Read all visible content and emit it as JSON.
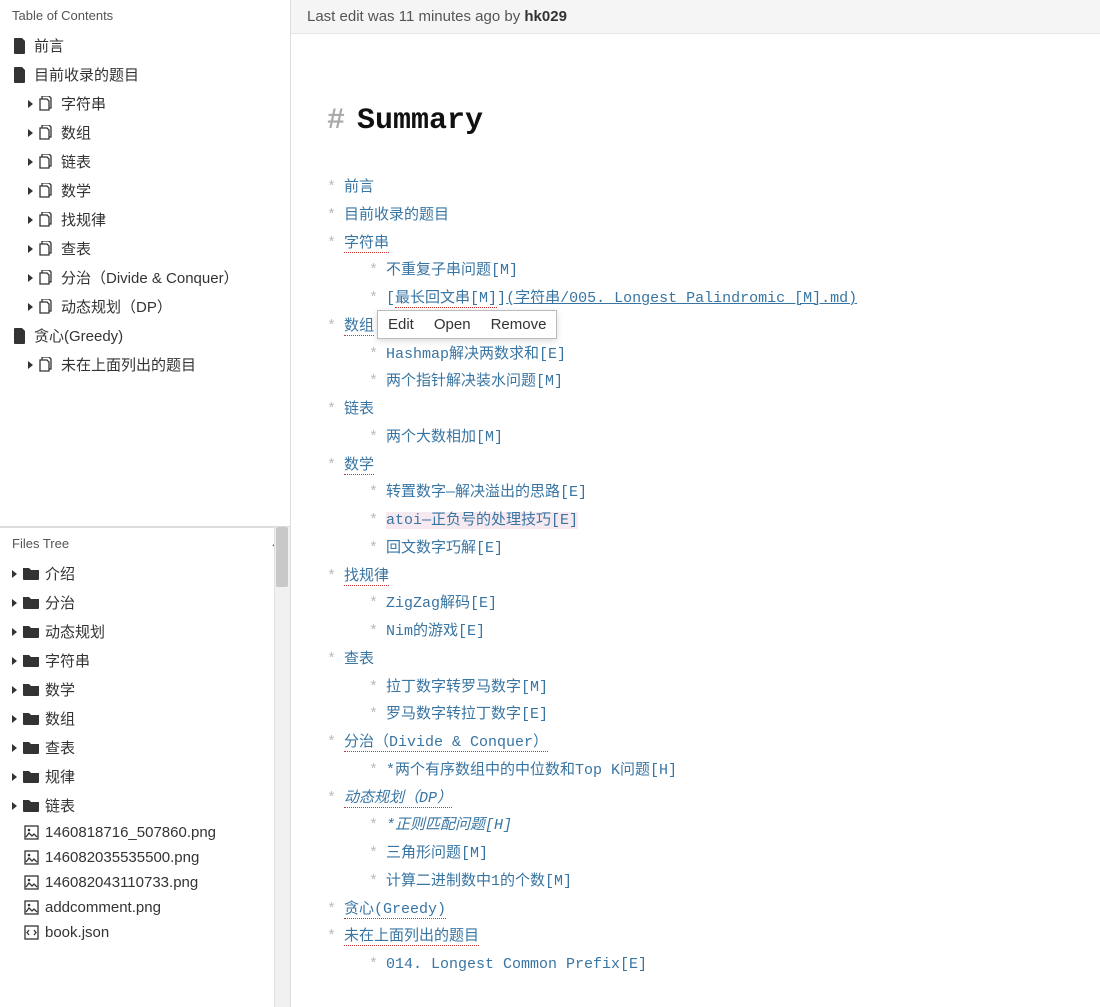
{
  "sidebar": {
    "toc_title": "Table of Contents",
    "files_title": "Files Tree",
    "toc": [
      {
        "kind": "file",
        "label": "前言",
        "nested": false
      },
      {
        "kind": "file",
        "label": "目前收录的题目",
        "nested": false
      },
      {
        "kind": "folder",
        "arrow": true,
        "label": "字符串",
        "nested": true,
        "icon": "files"
      },
      {
        "kind": "folder",
        "arrow": true,
        "label": "数组",
        "nested": true,
        "icon": "files"
      },
      {
        "kind": "folder",
        "arrow": true,
        "label": "链表",
        "nested": true,
        "icon": "files"
      },
      {
        "kind": "folder",
        "arrow": true,
        "label": "数学",
        "nested": true,
        "icon": "files"
      },
      {
        "kind": "folder",
        "arrow": true,
        "label": "找规律",
        "nested": true,
        "icon": "files"
      },
      {
        "kind": "folder",
        "arrow": true,
        "label": "查表",
        "nested": true,
        "icon": "files"
      },
      {
        "kind": "folder",
        "arrow": true,
        "label": "分治（Divide & Conquer）",
        "nested": true,
        "icon": "files"
      },
      {
        "kind": "folder",
        "arrow": true,
        "label": "动态规划（DP）",
        "nested": true,
        "icon": "files"
      },
      {
        "kind": "file",
        "label": "贪心(Greedy)",
        "nested": false
      },
      {
        "kind": "folder",
        "arrow": true,
        "label": "未在上面列出的题目",
        "nested": true,
        "icon": "files"
      }
    ],
    "files": [
      {
        "kind": "folder",
        "arrow": true,
        "label": "介绍"
      },
      {
        "kind": "folder",
        "arrow": true,
        "label": "分治"
      },
      {
        "kind": "folder",
        "arrow": true,
        "label": "动态规划"
      },
      {
        "kind": "folder",
        "arrow": true,
        "label": "字符串"
      },
      {
        "kind": "folder",
        "arrow": true,
        "label": "数学"
      },
      {
        "kind": "folder",
        "arrow": true,
        "label": "数组"
      },
      {
        "kind": "folder",
        "arrow": true,
        "label": "查表"
      },
      {
        "kind": "folder",
        "arrow": true,
        "label": "规律"
      },
      {
        "kind": "folder",
        "arrow": true,
        "label": "链表"
      },
      {
        "kind": "image",
        "label": "1460818716_507860.png"
      },
      {
        "kind": "image",
        "label": "146082035535500.png"
      },
      {
        "kind": "image",
        "label": "146082043110733.png"
      },
      {
        "kind": "image",
        "label": "addcomment.png"
      },
      {
        "kind": "code",
        "label": "book.json"
      }
    ]
  },
  "topbar": {
    "prefix": "Last edit was ",
    "time": "11 minutes ago",
    "by": " by ",
    "user": "hk029"
  },
  "editor": {
    "heading_hash": "#",
    "heading_text": "Summary",
    "context_menu": {
      "edit": "Edit",
      "open": "Open",
      "remove": "Remove"
    },
    "items": [
      {
        "level": 1,
        "type": "link",
        "text": "前言"
      },
      {
        "level": 1,
        "type": "link",
        "text": "目前收录的题目"
      },
      {
        "level": 1,
        "type": "squig",
        "text": "字符串"
      },
      {
        "level": 2,
        "type": "link",
        "text": "不重复子串问题[M]"
      },
      {
        "level": 2,
        "type": "raw",
        "bracket_text": "最长回文串[M]",
        "url": "(字符串/005. Longest Palindromic [M].md)"
      },
      {
        "level": 1,
        "type": "squig",
        "text": "数组",
        "ctx": true
      },
      {
        "level": 2,
        "type": "link",
        "text": "Hashmap解决两数求和[E]"
      },
      {
        "level": 2,
        "type": "link",
        "text": "两个指针解决装水问题[M]"
      },
      {
        "level": 1,
        "type": "link",
        "text": "链表"
      },
      {
        "level": 2,
        "type": "link",
        "text": "两个大数相加[M]"
      },
      {
        "level": 1,
        "type": "squig",
        "text": "数学"
      },
      {
        "level": 2,
        "type": "link",
        "text": "转置数字—解决溢出的思路[E]"
      },
      {
        "level": 2,
        "type": "link",
        "text": "atoi—正负号的处理技巧[E]",
        "hl": true
      },
      {
        "level": 2,
        "type": "link",
        "text": "回文数字巧解[E]"
      },
      {
        "level": 1,
        "type": "squig",
        "text": "找规律"
      },
      {
        "level": 2,
        "type": "link",
        "text": "ZigZag解码[E]"
      },
      {
        "level": 2,
        "type": "link",
        "text": "Nim的游戏[E]"
      },
      {
        "level": 1,
        "type": "link",
        "text": "查表"
      },
      {
        "level": 2,
        "type": "link",
        "text": "拉丁数字转罗马数字[M]"
      },
      {
        "level": 2,
        "type": "link",
        "text": "罗马数字转拉丁数字[E]"
      },
      {
        "level": 1,
        "type": "squig",
        "text": "分治（Divide & Conquer）"
      },
      {
        "level": 2,
        "type": "link",
        "text": "*两个有序数组中的中位数和Top K问题[H]"
      },
      {
        "level": 1,
        "type": "squig-em",
        "text": "动态规划（DP）"
      },
      {
        "level": 2,
        "type": "em",
        "text": "*正则匹配问题[H]"
      },
      {
        "level": 2,
        "type": "link",
        "text": "三角形问题[M]"
      },
      {
        "level": 2,
        "type": "link",
        "text": "计算二进制数中1的个数[M]"
      },
      {
        "level": 1,
        "type": "squig",
        "text": "贪心(Greedy)"
      },
      {
        "level": 1,
        "type": "squig",
        "text": "未在上面列出的题目"
      },
      {
        "level": 2,
        "type": "link",
        "text": "014. Longest Common Prefix[E]"
      }
    ]
  }
}
